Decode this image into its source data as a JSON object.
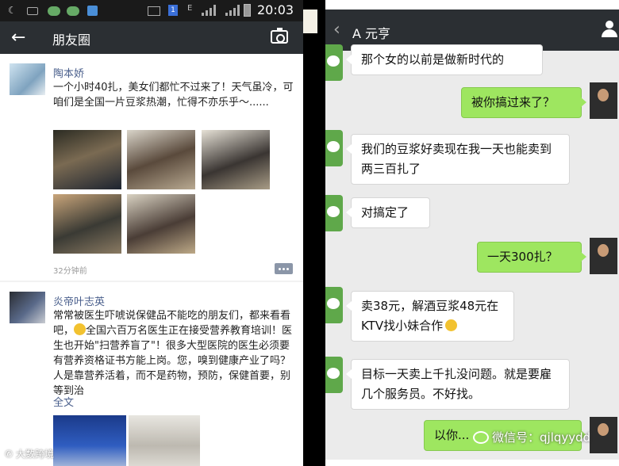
{
  "status_bar": {
    "time": "20:03",
    "sim_label": "1",
    "network_label": "E"
  },
  "moments": {
    "title": "朋友圈",
    "posts": [
      {
        "author": "陶本娇",
        "text": "一个小时40扎，美女们都忙不过来了！天气虽冷，可咱们是全国一片豆浆热潮，忙得不亦乐乎～......",
        "photo_count": 6,
        "time": "32分钟前"
      },
      {
        "author": "炎帝叶志英",
        "text_before_emoji": "常常被医生吓唬说保健品不能吃的朋友们，都来看看吧，",
        "text_after_emoji": "全国六百万名医生正在接受营养教育培训！医生也开始\"扫营养盲了\"！很多大型医院的医生必须要有营养资格证书方能上岗。您，嗅到健康产业了吗？人是靠营养活着，而不是药物，预防，保健首要，别等到治",
        "full_text_link": "全文"
      }
    ]
  },
  "chat": {
    "contact": "A 元亨",
    "messages": [
      {
        "side": "in",
        "text": "那个女的以前是做新时代的"
      },
      {
        "side": "out",
        "text": "被你搞过来了？"
      },
      {
        "side": "in",
        "text": "我们的豆浆好卖现在我一天也能卖到两三百扎了"
      },
      {
        "side": "in",
        "text": "对搞定了"
      },
      {
        "side": "out",
        "text": "一天300扎？"
      },
      {
        "side": "in",
        "text": "卖38元，解酒豆浆48元在KTV找小妹合作"
      },
      {
        "side": "in",
        "text": "目标一天卖上千扎没问题。就是要雇几个服务员。不好找。"
      },
      {
        "side": "out",
        "text": "以你..."
      }
    ]
  },
  "watermarks": {
    "left": "大数跨境",
    "right": "微信号：qjlqyydd"
  },
  "colors": {
    "green_bubble": "#9ee660",
    "title_bar": "#2b2f33",
    "link_blue": "#4a5f8c"
  }
}
